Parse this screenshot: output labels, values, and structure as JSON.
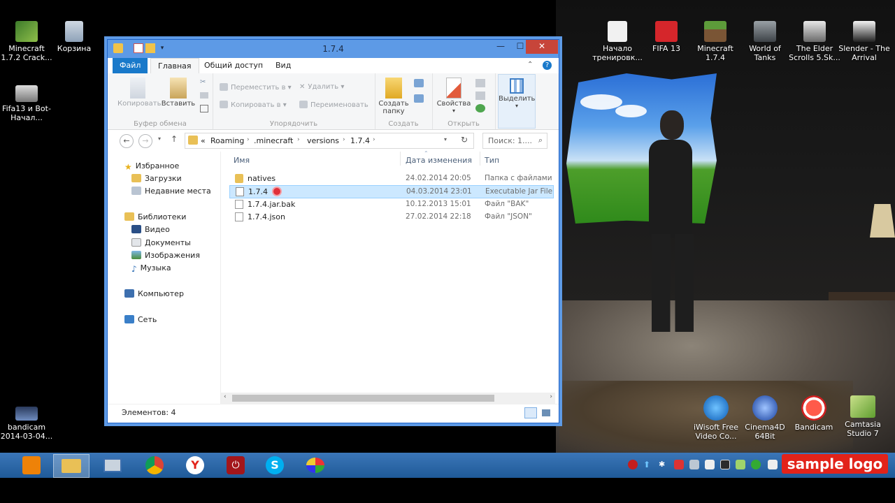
{
  "desktop_left_icons": [
    {
      "label": "Minecraft 1.7.2 Crack..."
    },
    {
      "label": "Корзина"
    },
    {
      "label": "Fifa13 и Bot-Начал..."
    },
    {
      "label": "bandicam 2014-03-04..."
    }
  ],
  "desktop_right_icons": [
    {
      "label": "Начало тренировк..."
    },
    {
      "label": "FIFA 13"
    },
    {
      "label": "Minecraft 1.7.4"
    },
    {
      "label": "World of Tanks"
    },
    {
      "label": "The Elder Scrolls 5.Sk..."
    },
    {
      "label": "Slender - The Arrival"
    }
  ],
  "desktop_bottom_icons": [
    {
      "label": "iWisoft Free Video Co..."
    },
    {
      "label": "Cinema4D 64Bit"
    },
    {
      "label": "Bandicam"
    },
    {
      "label": "Camtasia Studio 7"
    }
  ],
  "window": {
    "title": "1.7.4",
    "minimize": "—",
    "maximize": "☐",
    "close": "✕",
    "tabs": [
      "Файл",
      "Главная",
      "Общий доступ",
      "Вид"
    ],
    "ribbon": {
      "clipboard": {
        "copy": "Копировать",
        "paste": "Вставить",
        "group": "Буфер обмена"
      },
      "organize": {
        "move_to": "Переместить в",
        "copy_to": "Копировать в",
        "delete": "Удалить",
        "rename": "Переименовать",
        "group": "Упорядочить"
      },
      "create": {
        "new_folder": "Создать папку",
        "group": "Создать"
      },
      "open": {
        "properties": "Свойства",
        "group": "Открыть"
      },
      "select": {
        "select": "Выделить"
      }
    },
    "address": {
      "prefix": "«",
      "crumbs": [
        "Roaming",
        ".minecraft",
        "versions",
        "1.7.4"
      ],
      "search_placeholder": "Поиск: 1...."
    },
    "nav_pane": {
      "favorites": "Избранное",
      "downloads": "Загрузки",
      "recent": "Недавние места",
      "libraries": "Библиотеки",
      "video": "Видео",
      "documents": "Документы",
      "pictures": "Изображения",
      "music": "Музыка",
      "computer": "Компьютер",
      "network": "Сеть"
    },
    "columns": {
      "name": "Имя",
      "date": "Дата изменения",
      "type": "Тип"
    },
    "files": [
      {
        "name": "natives",
        "date": "24.02.2014 20:05",
        "type": "Папка с файлами",
        "kind": "folder"
      },
      {
        "name": "1.7.4",
        "date": "04.03.2014 23:01",
        "type": "Executable Jar File",
        "kind": "jar",
        "selected": true
      },
      {
        "name": "1.7.4.jar.bak",
        "date": "10.12.2013 15:01",
        "type": "Файл \"BAK\"",
        "kind": "file"
      },
      {
        "name": "1.7.4.json",
        "date": "27.02.2014 22:18",
        "type": "Файл \"JSON\"",
        "kind": "file"
      }
    ],
    "status": "Элементов: 4"
  },
  "taskbar": {
    "apps": [
      "odnoklassniki",
      "file-explorer",
      "remote-desktop",
      "chrome",
      "yandex-browser",
      "power",
      "skype",
      "paint"
    ]
  },
  "watermark": "sample logo",
  "colors": {
    "taskbar": "#1f5a98",
    "selection": "#cce8ff",
    "file_tab": "#1979ca",
    "close": "#c7453a"
  }
}
